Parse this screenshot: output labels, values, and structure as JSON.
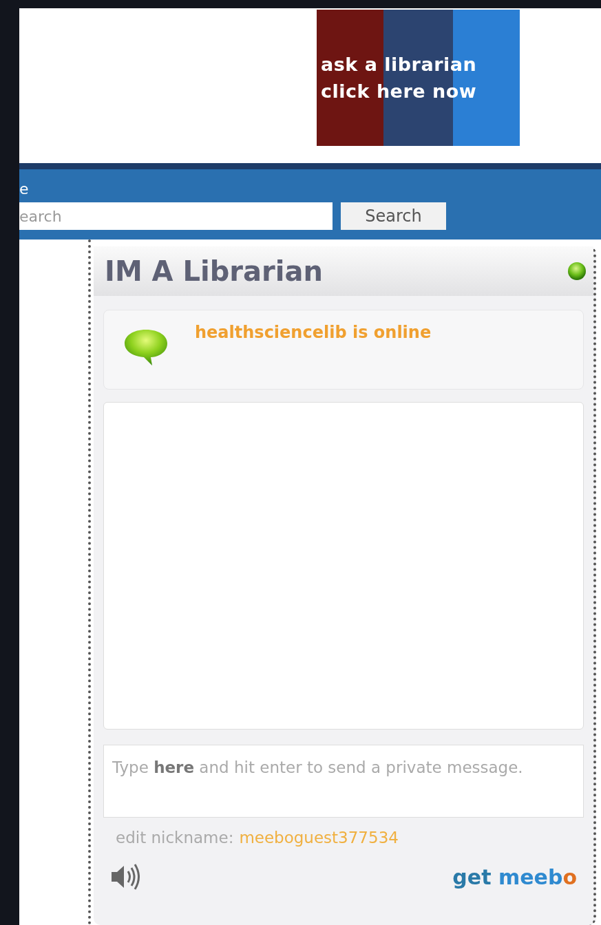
{
  "banner": {
    "line_1": "ask a librarian",
    "line_2": "click here now"
  },
  "nav": {
    "cut_text": "e",
    "search": {
      "placeholder": "earch"
    },
    "search_button": "Search"
  },
  "widget": {
    "title": "IM A Librarian",
    "online": true,
    "status": "healthsciencelib is online",
    "message_placeholder": "Type **here** and hit enter to send a private message.",
    "nickname_label": "edit nickname:",
    "nickname": "meeboguest377534",
    "logo": {
      "prefix": "get",
      "brand": "meeb",
      "brand_end": "o"
    }
  }
}
